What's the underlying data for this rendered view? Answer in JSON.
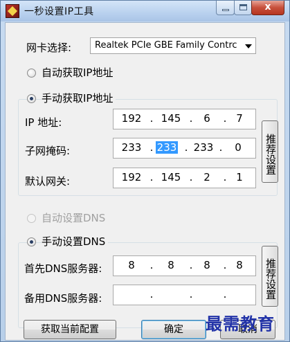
{
  "window": {
    "title": "一秒设置IP工具",
    "close_glyph": "x"
  },
  "nic": {
    "label": "网卡选择:",
    "selected": "Realtek PCIe GBE Family Contrc"
  },
  "ip_mode": {
    "auto_label": "自动获取IP地址",
    "manual_label": "手动获取IP地址",
    "selected": "manual"
  },
  "ip": {
    "address_label": "IP 地址:",
    "address": [
      "192",
      "145",
      "6",
      "7"
    ],
    "mask_label": "子网掩码:",
    "mask": [
      "233",
      "233",
      "233",
      "0"
    ],
    "mask_selected_octet": 1,
    "gateway_label": "默认网关:",
    "gateway": [
      "192",
      "145",
      "2",
      "1"
    ],
    "recommend_button": "推荐设置",
    "dot": "."
  },
  "dns_mode": {
    "auto_label": "自动设置DNS",
    "manual_label": "手动设置DNS",
    "selected": "manual",
    "auto_disabled": true
  },
  "dns": {
    "primary_label": "首先DNS服务器:",
    "primary": [
      "8",
      "8",
      "8",
      "8"
    ],
    "secondary_label": "备用DNS服务器:",
    "secondary": [
      "",
      "",
      "",
      ""
    ],
    "recommend_button": "推荐设置"
  },
  "footer": {
    "get_current_button": "获取当前配置",
    "ok_button": "确定",
    "cancel_button": "取消"
  },
  "watermark": "最需教育"
}
